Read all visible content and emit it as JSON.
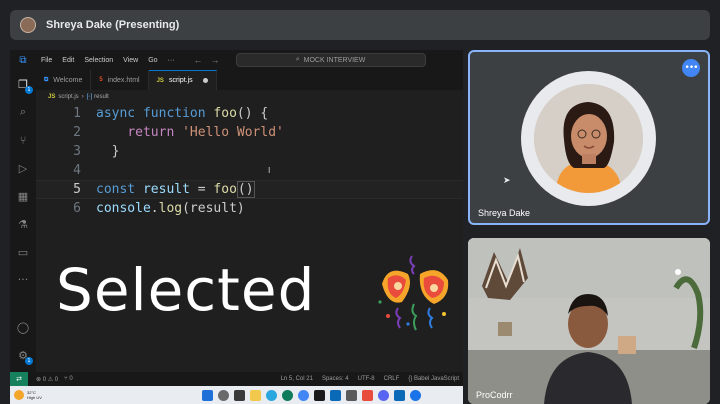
{
  "meet": {
    "presenter_title": "Shreya Dake (Presenting)",
    "participants": [
      {
        "name": "Shreya Dake"
      },
      {
        "name": "ProCodrr"
      }
    ],
    "more_options_icon": "more-horizontal-icon"
  },
  "vscode": {
    "menu": [
      "File",
      "Edit",
      "Selection",
      "View",
      "Go",
      "···"
    ],
    "search_label": "MOCK INTERVIEW",
    "tabs": [
      {
        "label": "Welcome",
        "active": false
      },
      {
        "label": "index.html",
        "active": false
      },
      {
        "label": "script.js",
        "active": true
      }
    ],
    "js_tag": "JS",
    "breadcrumb": {
      "file": "script.js",
      "symbol": "result"
    },
    "explorer_badge": "1",
    "settings_badge": "1",
    "lines": [
      {
        "n": "1"
      },
      {
        "n": "2"
      },
      {
        "n": "3"
      },
      {
        "n": "4"
      },
      {
        "n": "5"
      },
      {
        "n": "6"
      }
    ],
    "code": {
      "l1_kw1": "async",
      "l1_kw2": "function",
      "l1_fn": "foo",
      "l1_rest": "() {",
      "l2_kw": "return",
      "l2_str": "'Hello World'",
      "l3": "}",
      "l5_kw": "const",
      "l5_var": "result",
      "l5_eq": " = ",
      "l5_fn": "foo",
      "l5_rest": "()",
      "l6_obj": "console",
      "l6_dot": ".",
      "l6_fn": "log",
      "l6_rest": "(result)"
    },
    "overlay_text": "Selected",
    "status": {
      "problems": "⊗ 0 ⚠ 0",
      "ports": "⑂ 0",
      "position": "Ln 5, Col 21",
      "spaces": "Spaces: 4",
      "encoding": "UTF-8",
      "eol": "CRLF",
      "language": "{} Babel JavaScript"
    }
  },
  "taskbar": {
    "weather_temp": "32°C",
    "weather_desc": "High UV"
  },
  "colors": {
    "accent": "#0078d4",
    "meet_active_border": "#8ab4f8",
    "meet_button": "#4285f4"
  }
}
